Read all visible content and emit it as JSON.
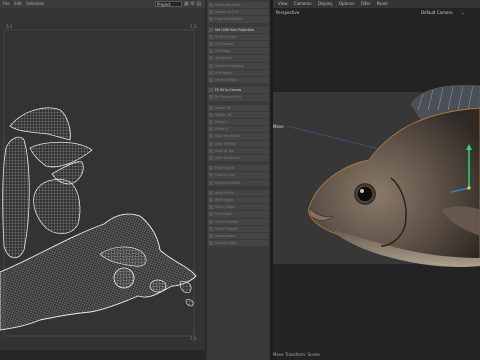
{
  "uv_editor": {
    "menu": [
      "File",
      "Edit",
      "Selection"
    ],
    "project_dropdown": "Project",
    "corner_labels": {
      "top_left": "0,1",
      "top_right": "1,1",
      "bottom_right": "1,0"
    }
  },
  "commands": [
    "Subdivide Faces",
    "Reduce to Trim",
    "Crop to Selection",
    "Set UVW from Projection",
    "Fit to Canvas",
    "Fit Selected",
    "Grid Align",
    "Straighten",
    "Optimize Mapping",
    "Grid Relax",
    "Iterative Relax",
    "Fit UV to Canvas",
    "Fit Canvas to UV",
    "Rotate 90",
    "Rotate -90",
    "Mirror U",
    "Mirror V",
    "Align Horizontal",
    "Align Vertical",
    "Align to Top",
    "Align to Bottom",
    "Pack Islands",
    "Pack by Size",
    "Equalize Islands",
    "Weld Points",
    "Weld Edges",
    "Stitch Edges",
    "Split Edges",
    "Select Overlap",
    "Select Flipped",
    "Show Seams",
    "Checker Map"
  ],
  "bright_commands": [
    3,
    11
  ],
  "viewport": {
    "menu": [
      "View",
      "Cameras",
      "Display",
      "Options",
      "Filter",
      "Panel"
    ],
    "view_name": "Perspective",
    "camera_name": "Default Camera",
    "light_label": "Move",
    "status": "Move Transform: Scene"
  },
  "colors": {
    "uv_wire": "#d2d2d2",
    "viewport_bg": "#373737",
    "fish_skin": "#5f5247",
    "gizmo_green": "#2fd27a",
    "gizmo_blue": "#3a7bd5"
  }
}
